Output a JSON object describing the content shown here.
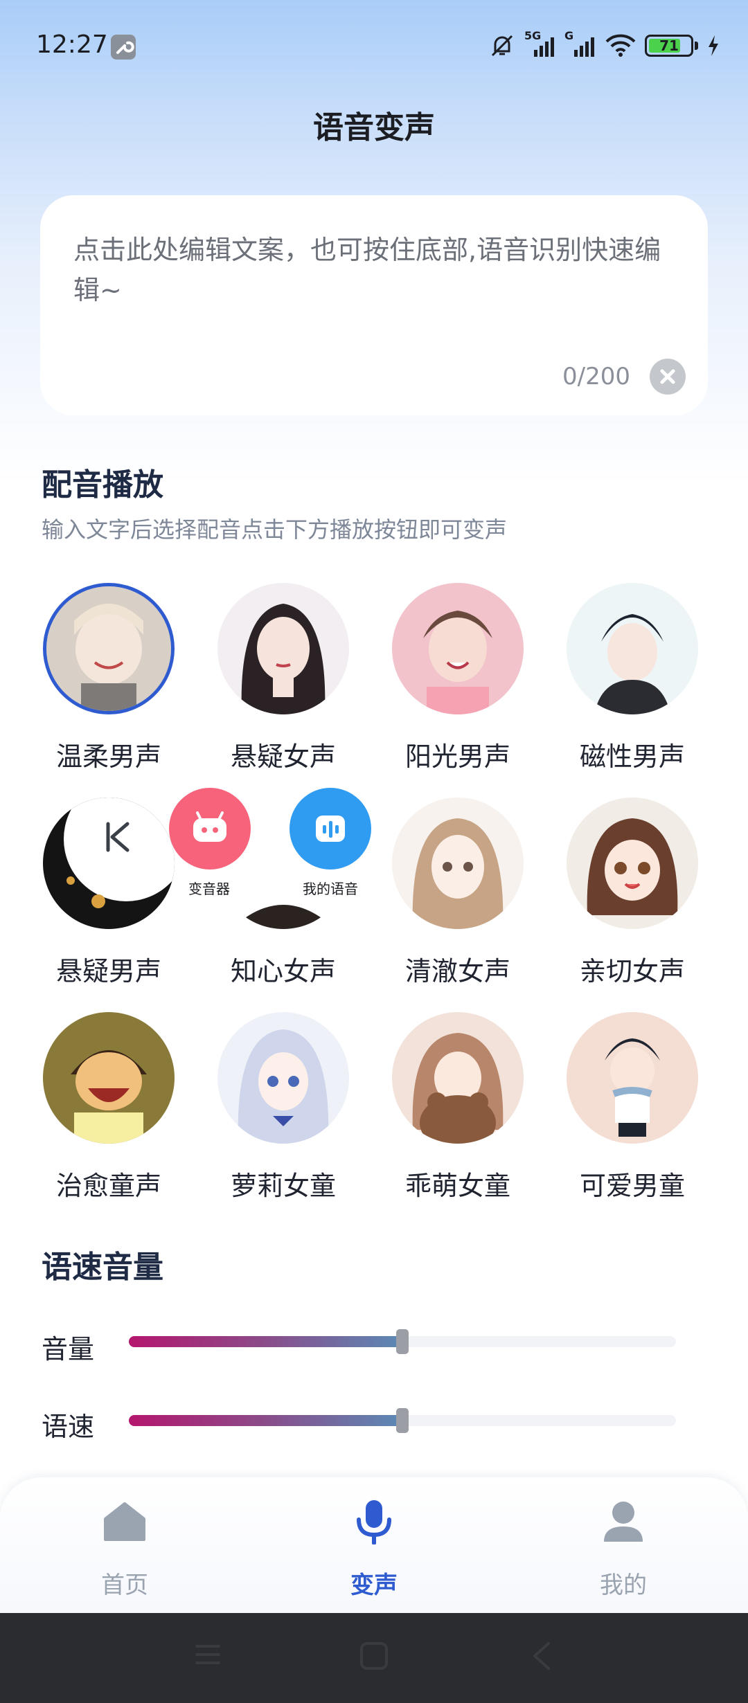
{
  "status": {
    "time": "12:27",
    "network_1": "5G",
    "network_2": "G",
    "battery": "71"
  },
  "page": {
    "title": "语音变声"
  },
  "editor": {
    "placeholder": "点击此处编辑文案，也可按住底部,语音识别快速编辑~",
    "count": "0/200"
  },
  "dubbing": {
    "title": "配音播放",
    "subtitle": "输入文字后选择配音点击下方播放按钮即可变声",
    "voices": [
      {
        "label": "温柔男声",
        "icon": "anime-boy-avatar",
        "selected": true
      },
      {
        "label": "悬疑女声",
        "icon": "anime-girl-avatar",
        "selected": false
      },
      {
        "label": "阳光男声",
        "icon": "anime-boy-avatar",
        "selected": false
      },
      {
        "label": "磁性男声",
        "icon": "anime-boy-avatar",
        "selected": false
      },
      {
        "label": "悬疑男声",
        "icon": "dark-moon-avatar",
        "selected": false
      },
      {
        "label": "知心女声",
        "icon": "anime-girl-avatar",
        "selected": false
      },
      {
        "label": "清澈女声",
        "icon": "anime-girl-avatar",
        "selected": false
      },
      {
        "label": "亲切女声",
        "icon": "anime-girl-avatar",
        "selected": false
      },
      {
        "label": "治愈童声",
        "icon": "cartoon-boy-avatar",
        "selected": false
      },
      {
        "label": "萝莉女童",
        "icon": "anime-girl-avatar",
        "selected": false
      },
      {
        "label": "乖萌女童",
        "icon": "anime-girl-avatar",
        "selected": false
      },
      {
        "label": "可爱男童",
        "icon": "anime-boy-avatar",
        "selected": false
      }
    ]
  },
  "floating": {
    "voice_changer_label": "变音器",
    "my_voice_label": "我的语音"
  },
  "speed_volume": {
    "title": "语速音量",
    "volume_label": "音量",
    "volume_level": 0.5,
    "speed_label": "语速",
    "speed_level": 0.5
  },
  "nav": {
    "home": "首页",
    "voice": "变声",
    "mine": "我的",
    "active_color": "#2f5bd0",
    "inactive_color": "#9aa3b0"
  }
}
